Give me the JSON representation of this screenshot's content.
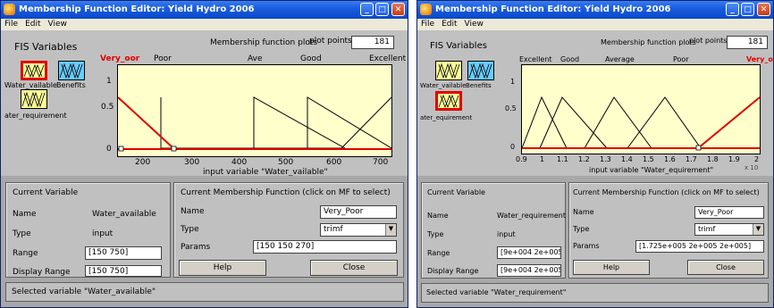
{
  "win1": {
    "title": "Membership Function Editor: Yield Hydro 2006",
    "menu": [
      "File",
      "Edit",
      "View"
    ],
    "fis_variables_label": "FIS Variables",
    "inputs": [
      "Water_vailable",
      "ater_requirement"
    ],
    "output": "Benefits",
    "mf_plots_label": "Membership function plots",
    "plot_points_label": "plot points:",
    "plot_points_value": "181",
    "mf_names": [
      "Very_oor",
      "Poor",
      "Ave",
      "Good",
      "Excellent"
    ],
    "x_ticks": [
      "200",
      "300",
      "400",
      "500",
      "600",
      "700"
    ],
    "y_ticks": [
      "1",
      "0.5",
      "0"
    ],
    "xlabel": "input variable \"Water_vailable\"",
    "current_variable": {
      "header": "Current Variable",
      "name_label": "Name",
      "name_value": "Water_available",
      "type_label": "Type",
      "type_value": "input",
      "range_label": "Range",
      "range_value": "[150 750]",
      "display_range_label": "Display Range",
      "display_range_value": "[150 750]"
    },
    "current_mf": {
      "header": "Current Membership Function (click on MF to select)",
      "name_label": "Name",
      "name_value": "Very_Poor",
      "type_label": "Type",
      "type_value": "trimf",
      "params_label": "Params",
      "params_value": "[150 150 270]"
    },
    "help_label": "Help",
    "close_label": "Close",
    "status": "Selected variable \"Water_available\""
  },
  "win2": {
    "title": "Membership Function Editor: Yield Hydro 2006",
    "menu": [
      "File",
      "Edit",
      "View"
    ],
    "fis_variables_label": "FIS Variables",
    "inputs": [
      "Water_vailable",
      "ater_equirement"
    ],
    "output": "Benefits",
    "mf_plots_label": "Membership function plots",
    "plot_points_label": "plot points:",
    "plot_points_value": "181",
    "mf_names": [
      "Excellent",
      "Good",
      "Average",
      "Poor",
      "Very_oor"
    ],
    "x_ticks": [
      "0.9",
      "1",
      "1.1",
      "1.2",
      "1.3",
      "1.4",
      "1.5",
      "1.6",
      "1.7",
      "1.8",
      "1.9",
      "2"
    ],
    "x_exponent": "x 10",
    "y_ticks": [
      "1",
      "0.5",
      "0"
    ],
    "xlabel": "input variable \"Water_equirement\"",
    "current_variable": {
      "header": "Current Variable",
      "name_label": "Name",
      "name_value": "Water_requirement",
      "type_label": "Type",
      "type_value": "input",
      "range_label": "Range",
      "range_value": "[9e+004 2e+005]",
      "display_range_label": "Display Range",
      "display_range_value": "[9e+004 2e+005]"
    },
    "current_mf": {
      "header": "Current Membership Function (click on MF to select)",
      "name_label": "Name",
      "name_value": "Very_Poor",
      "type_label": "Type",
      "type_value": "trimf",
      "params_label": "Params",
      "params_value": "[1.725e+005 2e+005 2e+005]"
    },
    "help_label": "Help",
    "close_label": "Close",
    "status": "Selected variable \"Water_requirement\""
  },
  "colors": {
    "titlebar": "#0b47c7",
    "plot_bg": "#ffffcc",
    "selected_mf": "#e00000",
    "mf_line": "#000000",
    "input_box": "#ffff99",
    "output_box": "#66ccff"
  }
}
